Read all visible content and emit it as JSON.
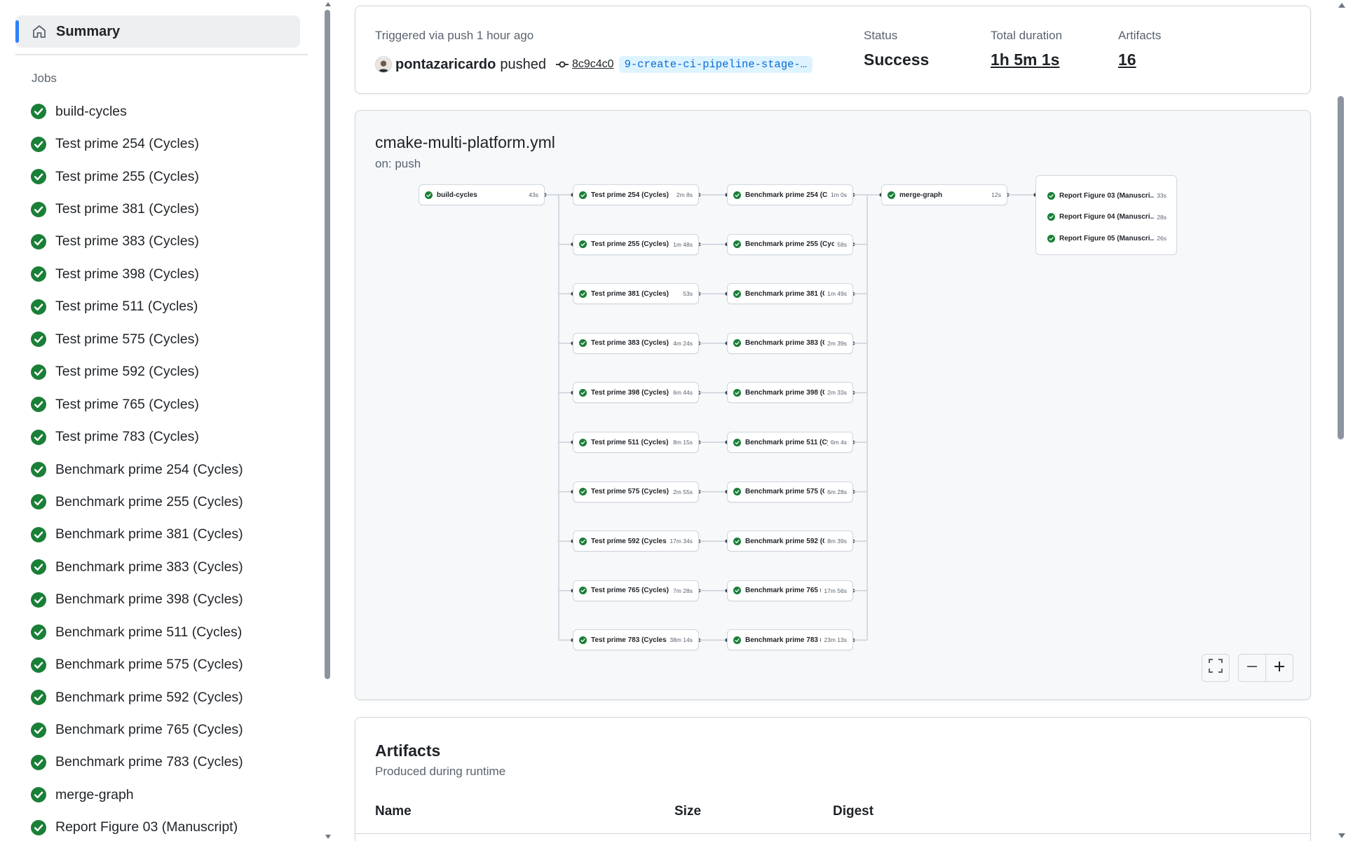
{
  "sidebar": {
    "summary_label": "Summary",
    "jobs_heading": "Jobs",
    "jobs": [
      {
        "label": "build-cycles",
        "status": "success"
      },
      {
        "label": "Test prime 254 (Cycles)",
        "status": "success"
      },
      {
        "label": "Test prime 255 (Cycles)",
        "status": "success"
      },
      {
        "label": "Test prime 381 (Cycles)",
        "status": "success"
      },
      {
        "label": "Test prime 383 (Cycles)",
        "status": "success"
      },
      {
        "label": "Test prime 398 (Cycles)",
        "status": "success"
      },
      {
        "label": "Test prime 511 (Cycles)",
        "status": "success"
      },
      {
        "label": "Test prime 575 (Cycles)",
        "status": "success"
      },
      {
        "label": "Test prime 592 (Cycles)",
        "status": "success"
      },
      {
        "label": "Test prime 765 (Cycles)",
        "status": "success"
      },
      {
        "label": "Test prime 783 (Cycles)",
        "status": "success"
      },
      {
        "label": "Benchmark prime 254 (Cycles)",
        "status": "success"
      },
      {
        "label": "Benchmark prime 255 (Cycles)",
        "status": "success"
      },
      {
        "label": "Benchmark prime 381 (Cycles)",
        "status": "success"
      },
      {
        "label": "Benchmark prime 383 (Cycles)",
        "status": "success"
      },
      {
        "label": "Benchmark prime 398 (Cycles)",
        "status": "success"
      },
      {
        "label": "Benchmark prime 511 (Cycles)",
        "status": "success"
      },
      {
        "label": "Benchmark prime 575 (Cycles)",
        "status": "success"
      },
      {
        "label": "Benchmark prime 592 (Cycles)",
        "status": "success"
      },
      {
        "label": "Benchmark prime 765 (Cycles)",
        "status": "success"
      },
      {
        "label": "Benchmark prime 783 (Cycles)",
        "status": "success"
      },
      {
        "label": "merge-graph",
        "status": "success"
      },
      {
        "label": "Report Figure 03 (Manuscript)",
        "status": "success"
      }
    ]
  },
  "run": {
    "trigger_text": "Triggered via push 1 hour ago",
    "actor": "pontazaricardo",
    "action": "pushed",
    "commit_sha": "8c9c4c0",
    "branch": "9-create-ci-pipeline-stage-…",
    "status_label": "Status",
    "status_value": "Success",
    "duration_label": "Total duration",
    "duration_value": "1h 5m 1s",
    "artifacts_label": "Artifacts",
    "artifacts_value": "16"
  },
  "workflow": {
    "file": "cmake-multi-platform.yml",
    "trigger": "on: push",
    "build": {
      "label": "build-cycles",
      "time": "43s"
    },
    "tests": [
      {
        "label": "Test prime 254 (Cycles)",
        "time": "2m 8s"
      },
      {
        "label": "Test prime 255 (Cycles)",
        "time": "1m 48s"
      },
      {
        "label": "Test prime 381 (Cycles)",
        "time": "53s"
      },
      {
        "label": "Test prime 383 (Cycles)",
        "time": "4m 24s"
      },
      {
        "label": "Test prime 398 (Cycles)",
        "time": "6m 44s"
      },
      {
        "label": "Test prime 511 (Cycles)",
        "time": "8m 15s"
      },
      {
        "label": "Test prime 575 (Cycles)",
        "time": "2m 55s"
      },
      {
        "label": "Test prime 592 (Cycles)",
        "time": "17m 34s"
      },
      {
        "label": "Test prime 765 (Cycles)",
        "time": "7m 28s"
      },
      {
        "label": "Test prime 783 (Cycles)",
        "time": "38m 14s"
      }
    ],
    "benchmarks": [
      {
        "label": "Benchmark prime 254 (C...",
        "time": "1m 0s"
      },
      {
        "label": "Benchmark prime 255 (Cycl...",
        "time": "58s"
      },
      {
        "label": "Benchmark prime 381 (C...",
        "time": "1m 49s"
      },
      {
        "label": "Benchmark prime 383 (C...",
        "time": "2m 39s"
      },
      {
        "label": "Benchmark prime 398 (C...",
        "time": "2m 33s"
      },
      {
        "label": "Benchmark prime 511 (Cy...",
        "time": "6m 4s"
      },
      {
        "label": "Benchmark prime 575 (C...",
        "time": "6m 28s"
      },
      {
        "label": "Benchmark prime 592 (C...",
        "time": "8m 39s"
      },
      {
        "label": "Benchmark prime 765 (...",
        "time": "17m 56s"
      },
      {
        "label": "Benchmark prime 783 (...",
        "time": "23m 13s"
      }
    ],
    "merge": {
      "label": "merge-graph",
      "time": "12s"
    },
    "reports": [
      {
        "label": "Report Figure 03 (Manuscri...",
        "time": "33s"
      },
      {
        "label": "Report Figure 04 (Manuscri...",
        "time": "28s"
      },
      {
        "label": "Report Figure 05 (Manuscri...",
        "time": "26s"
      }
    ]
  },
  "artifacts_section": {
    "title": "Artifacts",
    "subtitle": "Produced during runtime",
    "columns": [
      "Name",
      "Size",
      "Digest"
    ]
  },
  "colors": {
    "success": "#1a7f37",
    "accent": "#2f81f7",
    "branch_bg": "#ddf4ff",
    "branch_fg": "#0969da"
  },
  "icons": {
    "summary": "home-icon",
    "job_status": "check-circle-icon",
    "commit": "git-commit-icon",
    "fullscreen": "fullscreen-icon",
    "zoom_out": "zoom-out-icon",
    "zoom_in": "zoom-in-icon"
  }
}
